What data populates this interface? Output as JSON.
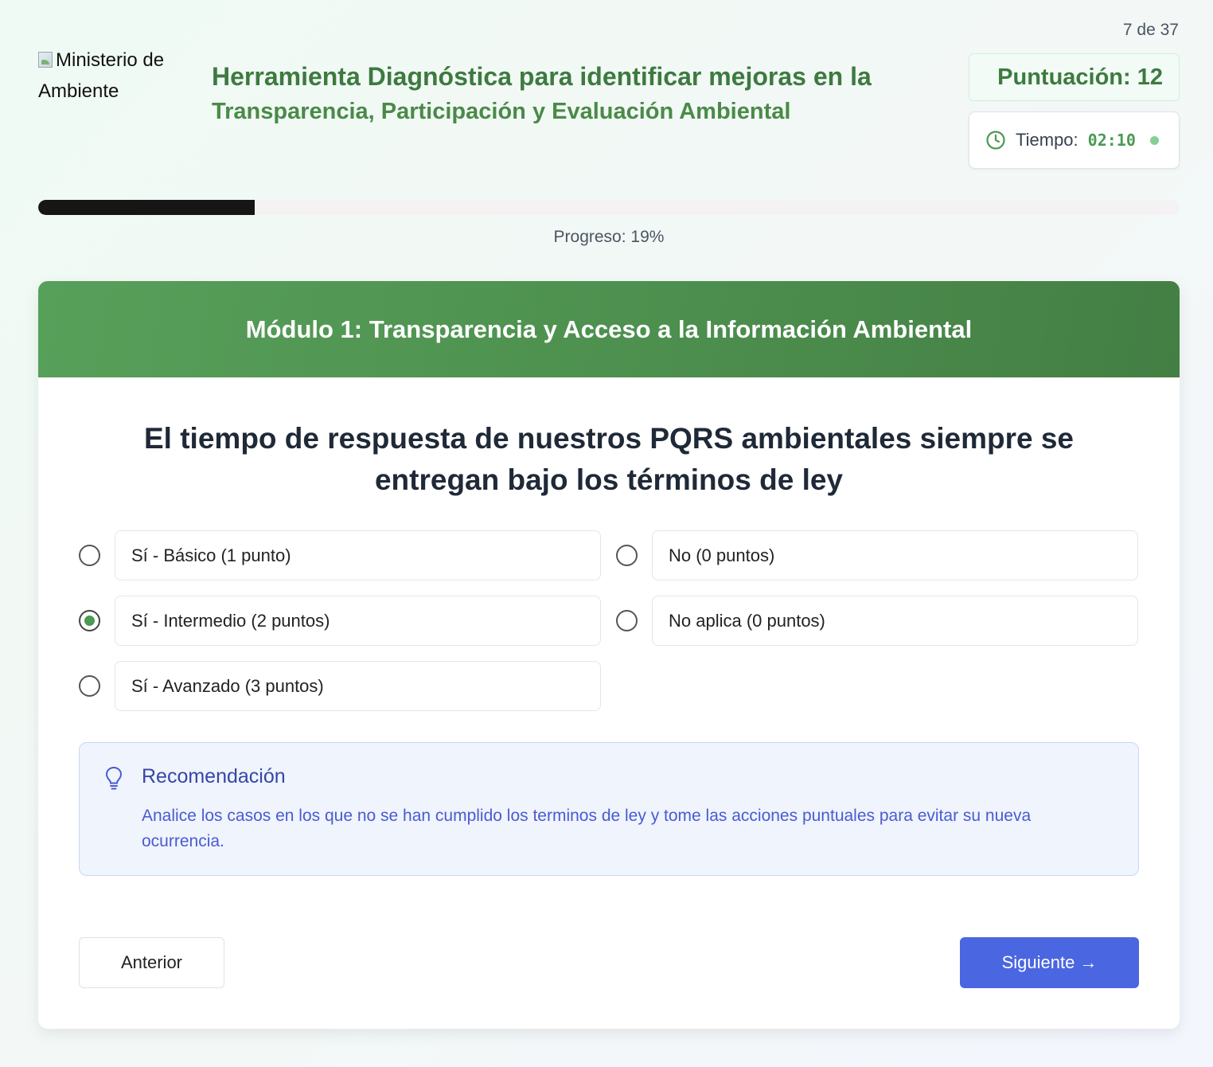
{
  "header": {
    "logo_alt": "Ministerio de Ambiente",
    "title_line1": "Herramienta Diagnóstica para identificar mejoras en la",
    "title_line2": "Transparencia, Participación y Evaluación Ambiental",
    "counter": "7 de 37",
    "score": "Puntuación: 12",
    "time_label": "Tiempo:",
    "time_value": "02:10",
    "icons": {
      "clock": "clock-icon",
      "status": "live-dot-icon"
    }
  },
  "progress": {
    "percent": 19,
    "label": "Progreso: 19%"
  },
  "module": {
    "title": "Módulo 1: Transparencia y Acceso a la Información Ambiental"
  },
  "question": {
    "text": "El tiempo de respuesta de nuestros PQRS ambientales siempre se entregan bajo los términos de ley",
    "selected_index": 1,
    "options": [
      {
        "label": "Sí - Básico (1 punto)"
      },
      {
        "label": "Sí - Intermedio (2 puntos)"
      },
      {
        "label": "Sí - Avanzado (3 puntos)"
      },
      {
        "label": "No (0 puntos)"
      },
      {
        "label": "No aplica (0 puntos)"
      }
    ]
  },
  "recommendation": {
    "icon": "lightbulb-icon",
    "title": "Recomendación",
    "text": "Analice los casos en los que no se han cumplido los terminos de ley y tome las acciones puntuales para evitar su nueva ocurrencia."
  },
  "nav": {
    "prev_label": "Anterior",
    "next_label": "Siguiente →"
  },
  "colors": {
    "primary_green": "#4d8f4e",
    "accent_blue": "#4a66e0",
    "progress_fill": "#161616"
  }
}
